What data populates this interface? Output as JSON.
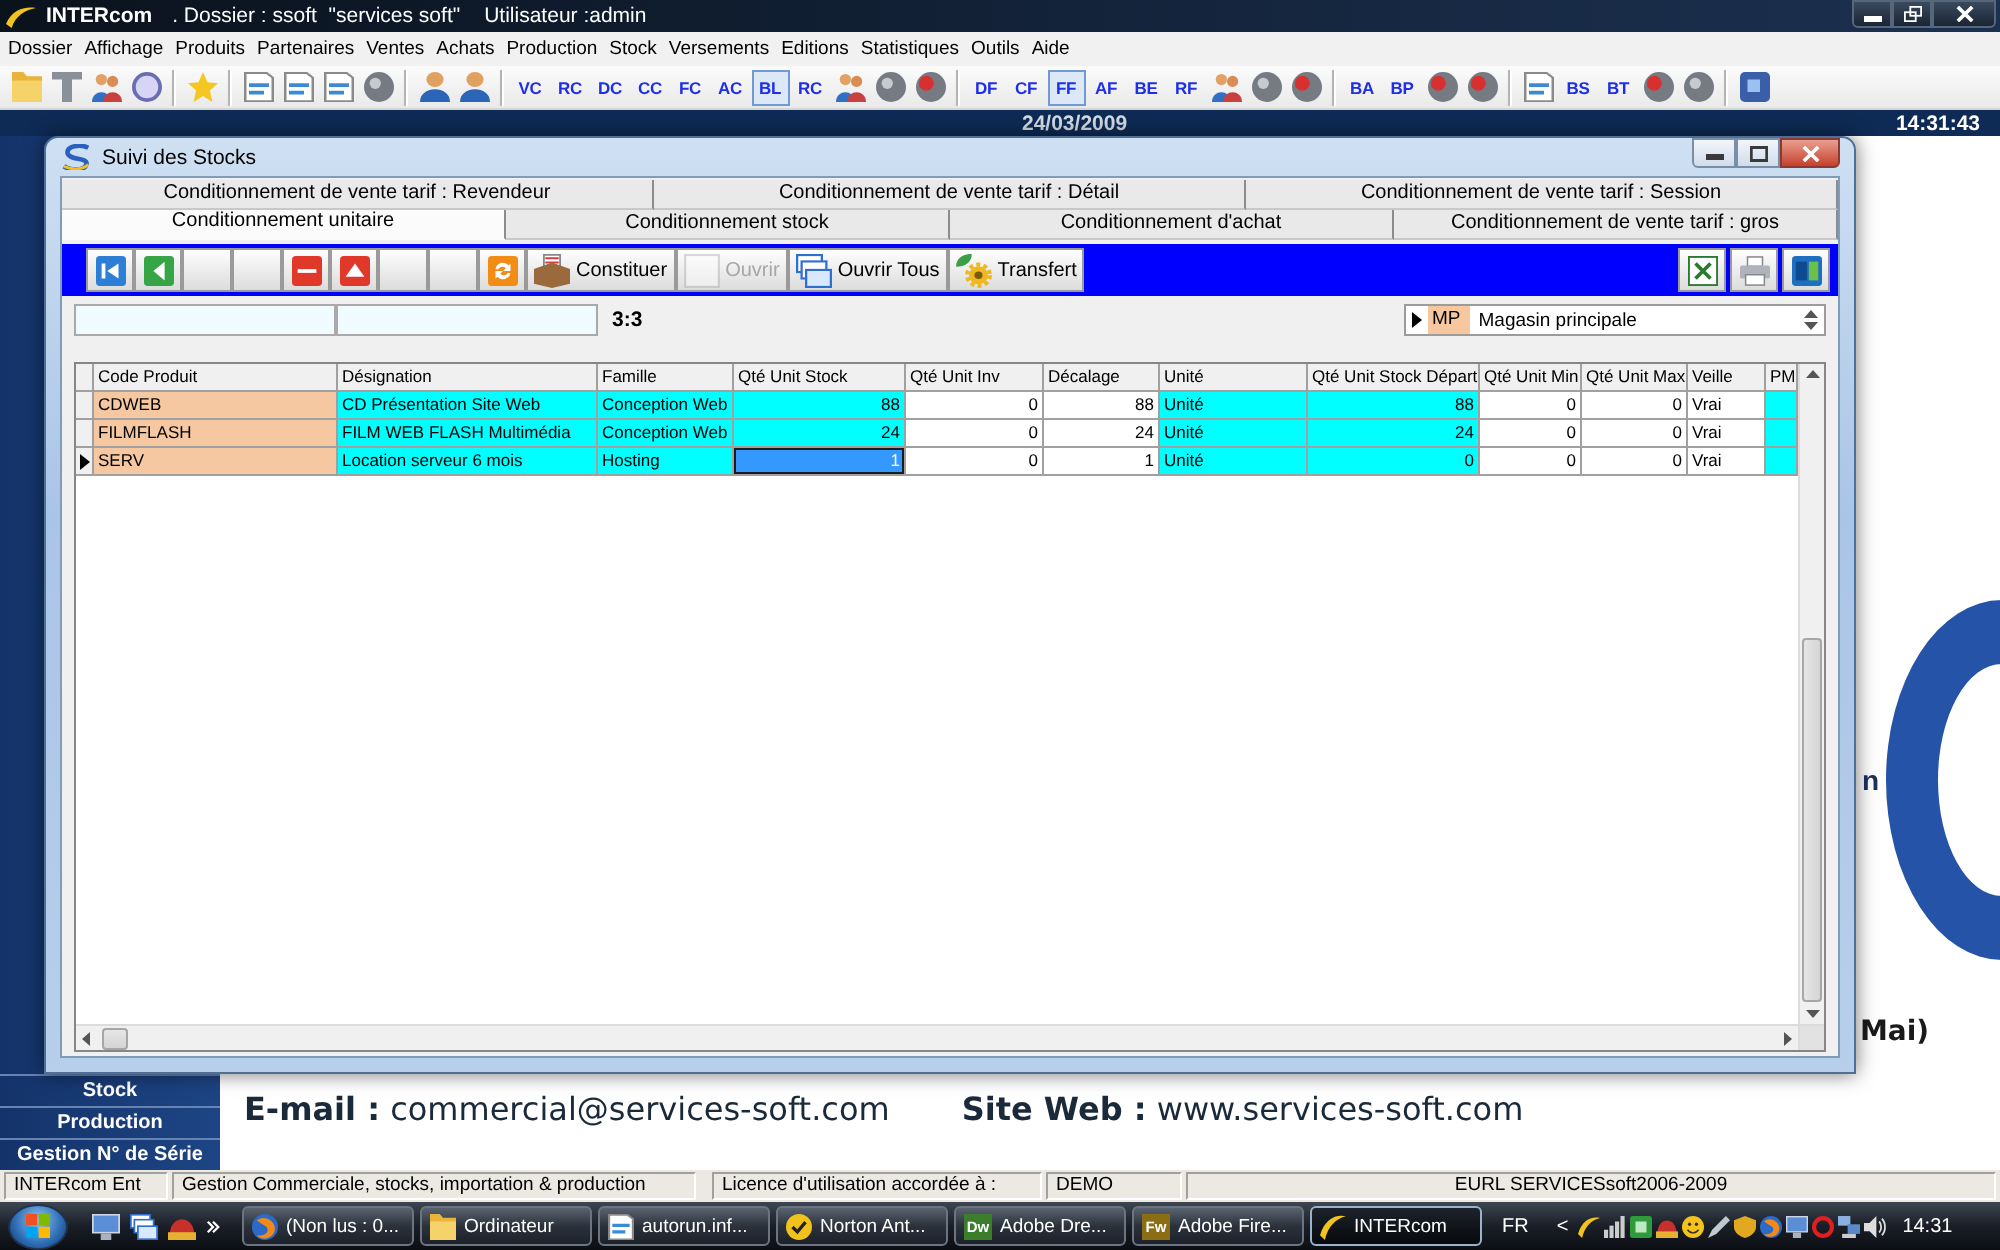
{
  "app": {
    "name": "INTERcom",
    "dossier": ". Dossier : ssoft  \"services soft\"",
    "user": "Utilisateur :admin"
  },
  "menu": [
    "Dossier",
    "Affichage",
    "Produits",
    "Partenaires",
    "Ventes",
    "Achats",
    "Production",
    "Stock",
    "Versements",
    "Editions",
    "Statistiques",
    "Outils",
    "Aide"
  ],
  "toolbar": {
    "groups": [
      [
        {
          "kind": "icon",
          "selected": false
        },
        {
          "kind": "icon",
          "selected": false
        },
        {
          "kind": "icon",
          "selected": false
        },
        {
          "kind": "icon",
          "selected": false
        }
      ],
      [
        {
          "kind": "icon",
          "selected": false
        }
      ],
      [
        {
          "kind": "icon",
          "selected": false
        },
        {
          "kind": "icon",
          "selected": false
        },
        {
          "kind": "icon",
          "selected": false
        },
        {
          "kind": "icon",
          "selected": false
        }
      ],
      [
        {
          "kind": "icon",
          "selected": false
        },
        {
          "kind": "icon",
          "selected": false
        }
      ],
      [
        {
          "kind": "letters",
          "label": "VC",
          "selected": false
        },
        {
          "kind": "letters",
          "label": "RC",
          "selected": false
        },
        {
          "kind": "letters",
          "label": "DC",
          "selected": false
        },
        {
          "kind": "letters",
          "label": "CC",
          "selected": false
        },
        {
          "kind": "letters",
          "label": "FC",
          "selected": false
        },
        {
          "kind": "letters",
          "label": "AC",
          "selected": false
        },
        {
          "kind": "letters",
          "label": "BL",
          "selected": true
        },
        {
          "kind": "letters",
          "label": "RC",
          "selected": false
        },
        {
          "kind": "icon",
          "selected": false
        },
        {
          "kind": "icon",
          "selected": false
        },
        {
          "kind": "icon",
          "selected": false
        }
      ],
      [
        {
          "kind": "letters",
          "label": "DF",
          "selected": false
        },
        {
          "kind": "letters",
          "label": "CF",
          "selected": false
        },
        {
          "kind": "letters",
          "label": "FF",
          "selected": true
        },
        {
          "kind": "letters",
          "label": "AF",
          "selected": false
        },
        {
          "kind": "letters",
          "label": "BE",
          "selected": false
        },
        {
          "kind": "letters",
          "label": "RF",
          "selected": false
        },
        {
          "kind": "icon",
          "selected": false
        },
        {
          "kind": "icon",
          "selected": false
        },
        {
          "kind": "icon",
          "selected": false
        }
      ],
      [
        {
          "kind": "letters",
          "label": "BA",
          "selected": false
        },
        {
          "kind": "letters",
          "label": "BP",
          "selected": false
        },
        {
          "kind": "icon",
          "selected": false
        },
        {
          "kind": "icon",
          "selected": false
        }
      ],
      [
        {
          "kind": "icon",
          "selected": false
        },
        {
          "kind": "letters",
          "label": "BS",
          "selected": false
        },
        {
          "kind": "letters",
          "label": "BT",
          "selected": false
        },
        {
          "kind": "icon",
          "selected": false
        },
        {
          "kind": "icon",
          "selected": false
        }
      ],
      [
        {
          "kind": "icon",
          "selected": false
        }
      ]
    ]
  },
  "date_bar": {
    "date": "24/03/2009",
    "time": "14:31:43"
  },
  "sidebar": [
    "Stock",
    "Production",
    "Gestion N° de Série"
  ],
  "backdrop": {
    "fragments": [
      "n",
      "Mai)"
    ],
    "contact": [
      "**E-mail :** commercial@services-soft.com",
      "**Site Web :** www.services-soft.com"
    ]
  },
  "stock_window": {
    "title": "Suivi des Stocks",
    "tab_rows": [
      [
        {
          "label": "Conditionnement de vente tarif : Revendeur",
          "selected": false
        },
        {
          "label": "Conditionnement de vente tarif : Détail",
          "selected": false
        },
        {
          "label": "Conditionnement de vente tarif : Session",
          "selected": false
        }
      ],
      [
        {
          "label": "Conditionnement unitaire",
          "selected": true
        },
        {
          "label": "Conditionnement stock",
          "selected": false
        },
        {
          "label": "Conditionnement d'achat",
          "selected": false
        },
        {
          "label": "Conditionnement de vente tarif : gros",
          "selected": false
        }
      ]
    ],
    "actions": [
      {
        "kind": "icon",
        "disabled": false
      },
      {
        "kind": "icon",
        "disabled": false
      },
      {
        "kind": "blank",
        "disabled": false
      },
      {
        "kind": "blank",
        "disabled": false
      },
      {
        "kind": "icon",
        "disabled": false
      },
      {
        "kind": "icon",
        "disabled": false
      },
      {
        "kind": "blank",
        "disabled": false
      },
      {
        "kind": "blank",
        "disabled": false
      },
      {
        "kind": "icon",
        "disabled": false
      },
      {
        "kind": "labeled",
        "label": "Constituer",
        "disabled": false
      },
      {
        "kind": "labeled",
        "label": "Ouvrir",
        "disabled": true
      },
      {
        "kind": "labeled",
        "label": "Ouvrir Tous",
        "disabled": false
      },
      {
        "kind": "labeled",
        "label": "Transfert",
        "disabled": false
      }
    ],
    "record_position": "3:3",
    "store": {
      "code": "MP",
      "name": "Magasin principale"
    },
    "grid": {
      "columns": [
        {
          "label": "Code Produit",
          "kind": "key"
        },
        {
          "label": "Désignation",
          "kind": "text",
          "editable": false
        },
        {
          "label": "Famille",
          "kind": "text",
          "editable": false
        },
        {
          "label": "Qté Unit Stock",
          "kind": "number",
          "editable": false
        },
        {
          "label": "Qté Unit Inv",
          "kind": "number",
          "editable": true
        },
        {
          "label": "Décalage",
          "kind": "number",
          "editable": true
        },
        {
          "label": "Unité",
          "kind": "text",
          "editable": false
        },
        {
          "label": "Qté Unit Stock Départ",
          "kind": "number",
          "editable": false
        },
        {
          "label": "Qté Unit Min",
          "kind": "number",
          "editable": true
        },
        {
          "label": "Qté Unit Max",
          "kind": "number",
          "editable": true
        },
        {
          "label": "Veille",
          "kind": "text",
          "editable": true
        },
        {
          "label": "PM",
          "kind": "text",
          "editable": false
        }
      ],
      "rows": [
        {
          "selected": false,
          "cells": [
            {
              "text": "CDWEB",
              "selected": false
            },
            {
              "text": "CD Présentation Site Web",
              "selected": false
            },
            {
              "text": "Conception Web",
              "selected": false
            },
            {
              "text": "88",
              "selected": false
            },
            {
              "text": "0",
              "selected": false
            },
            {
              "text": "88",
              "selected": false
            },
            {
              "text": "Unité",
              "selected": false
            },
            {
              "text": "88",
              "selected": false
            },
            {
              "text": "0",
              "selected": false
            },
            {
              "text": "0",
              "selected": false
            },
            {
              "text": "Vrai",
              "selected": false
            }
          ]
        },
        {
          "selected": false,
          "cells": [
            {
              "text": "FILMFLASH",
              "selected": false
            },
            {
              "text": "FILM WEB FLASH Multimédia",
              "selected": false
            },
            {
              "text": "Conception Web",
              "selected": false
            },
            {
              "text": "24",
              "selected": false
            },
            {
              "text": "0",
              "selected": false
            },
            {
              "text": "24",
              "selected": false
            },
            {
              "text": "Unité",
              "selected": false
            },
            {
              "text": "24",
              "selected": false
            },
            {
              "text": "0",
              "selected": false
            },
            {
              "text": "0",
              "selected": false
            },
            {
              "text": "Vrai",
              "selected": false
            }
          ]
        },
        {
          "selected": true,
          "cells": [
            {
              "text": "SERV",
              "selected": false
            },
            {
              "text": "Location serveur 6 mois",
              "selected": false
            },
            {
              "text": "Hosting",
              "selected": false
            },
            {
              "text": "1",
              "selected": true
            },
            {
              "text": "0",
              "selected": false
            },
            {
              "text": "1",
              "selected": false
            },
            {
              "text": "Unité",
              "selected": false
            },
            {
              "text": "0",
              "selected": false
            },
            {
              "text": "0",
              "selected": false
            },
            {
              "text": "0",
              "selected": false
            },
            {
              "text": "Vrai",
              "selected": false
            }
          ]
        }
      ]
    }
  },
  "status_bar": [
    "INTERcom Ent",
    "Gestion Commerciale, stocks, importation & production",
    "Licence d'utilisation accordée à :",
    "DEMO",
    "EURL SERVICESsoft2006-2009"
  ],
  "taskbar": {
    "tasks": [
      {
        "label": "(Non lus : 0...",
        "selected": false
      },
      {
        "label": "Ordinateur",
        "selected": false
      },
      {
        "label": "autorun.inf...",
        "selected": false
      },
      {
        "label": "Norton Ant...",
        "selected": false
      },
      {
        "label": "Adobe Dre...",
        "badge": {
          "text": "Dw",
          "color": "#3b7d2b"
        },
        "selected": false
      },
      {
        "label": "Adobe Fire...",
        "badge": {
          "text": "Fw",
          "color": "#8b6d14"
        },
        "selected": false
      },
      {
        "label": "INTERcom",
        "selected": true
      }
    ],
    "language": "FR",
    "tray_toggle": "<",
    "clock": "14:31"
  }
}
